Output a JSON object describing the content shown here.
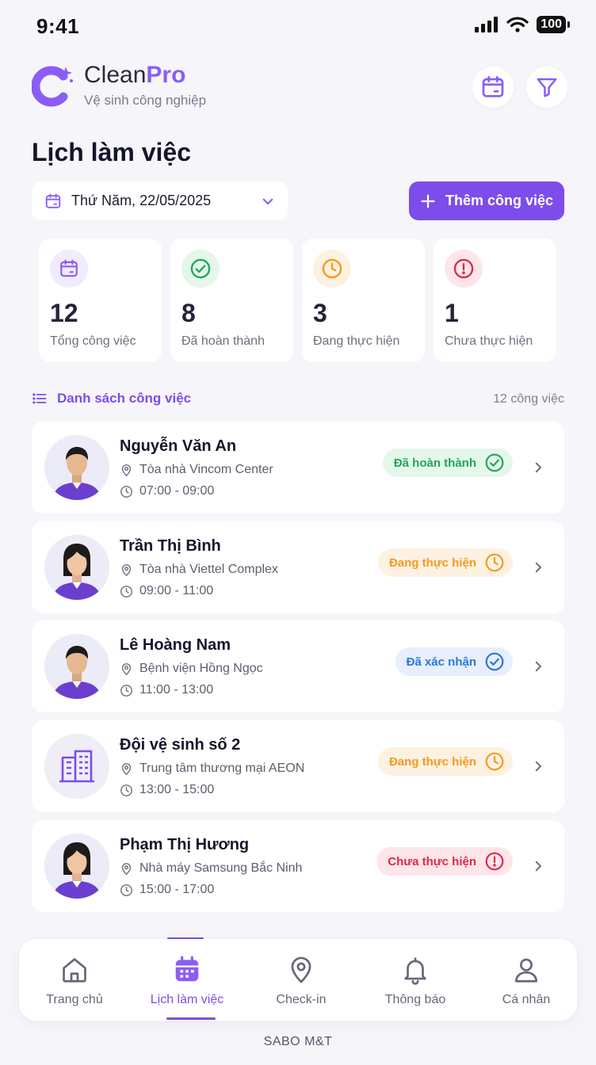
{
  "status_bar": {
    "time": "9:41",
    "battery": "100"
  },
  "brand": {
    "name_part1": "Clean",
    "name_part2": "Pro",
    "subtitle": "Vệ sinh công nghiệp"
  },
  "page": {
    "title": "Lịch làm việc"
  },
  "date_selector": {
    "value": "Thứ Năm, 22/05/2025"
  },
  "add_button": {
    "label": "Thêm công việc"
  },
  "stats": [
    {
      "value": "12",
      "label": "Tổng công việc",
      "icon": "calendar-icon",
      "color": "#8b5cf6"
    },
    {
      "value": "8",
      "label": "Đã hoàn thành",
      "icon": "check-circle-icon",
      "color": "#22a55a"
    },
    {
      "value": "3",
      "label": "Đang thực hiện",
      "icon": "clock-icon",
      "color": "#f29a1f"
    },
    {
      "value": "1",
      "label": "Chưa thực hiện",
      "icon": "alert-circle-icon",
      "color": "#e0284a"
    }
  ],
  "task_list": {
    "heading": "Danh sách công việc",
    "count": "12 công việc",
    "items": [
      {
        "name": "Nguyễn Văn An",
        "location": "Tòa nhà Vincom Center",
        "time": "07:00 - 09:00",
        "status": "Đã hoàn thành",
        "status_color": "#22a55a",
        "status_bg": "#e4f7ea",
        "avatar": "male-staff-avatar"
      },
      {
        "name": "Trần Thị Bình",
        "location": "Tòa nhà Viettel Complex",
        "time": "09:00 - 11:00",
        "status": "Đang thực hiện",
        "status_color": "#f29a1f",
        "status_bg": "#fdf1e1",
        "avatar": "female-staff-avatar"
      },
      {
        "name": "Lê Hoàng Nam",
        "location": "Bệnh viện Hồng Ngọc",
        "time": "11:00 - 13:00",
        "status": "Đã xác nhận",
        "status_color": "#2f74d6",
        "status_bg": "#e6effb",
        "avatar": "male-staff-avatar"
      },
      {
        "name": "Đội vệ sinh số 2",
        "location": "Trung tâm thương mại AEON",
        "time": "13:00 - 15:00",
        "status": "Đang thực hiện",
        "status_color": "#f29a1f",
        "status_bg": "#fdf1e1",
        "avatar": "building-icon"
      },
      {
        "name": "Phạm Thị Hương",
        "location": "Nhà máy Samsung Bắc Ninh",
        "time": "15:00 - 17:00",
        "status": "Chưa thực hiện",
        "status_color": "#e0284a",
        "status_bg": "#fde6ea",
        "avatar": "female-staff-avatar"
      }
    ]
  },
  "bottom_nav": {
    "items": [
      {
        "label": "Trang chủ",
        "icon": "home-icon"
      },
      {
        "label": "Lịch làm việc",
        "icon": "calendar-icon",
        "active": true
      },
      {
        "label": "Check-in",
        "icon": "map-pin-icon"
      },
      {
        "label": "Thông báo",
        "icon": "bell-icon"
      },
      {
        "label": "Cá nhân",
        "icon": "user-icon"
      }
    ]
  },
  "footer": {
    "text": "SABO M&T"
  }
}
